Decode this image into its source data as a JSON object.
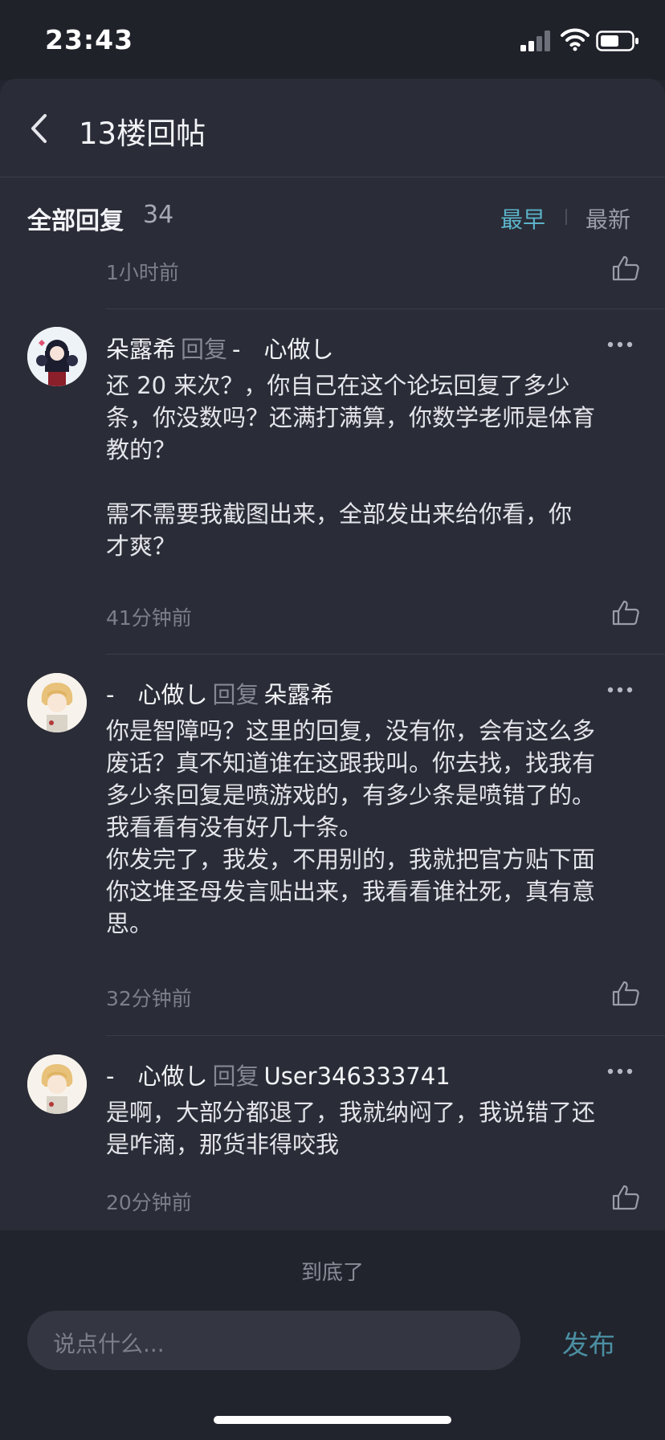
{
  "status": {
    "time": "23:43"
  },
  "nav": {
    "title": "13楼回帖"
  },
  "sort": {
    "all_replies": "全部回复",
    "count": "34",
    "earliest": "最早",
    "newest": "最新"
  },
  "top_item": {
    "time": "1小时前"
  },
  "comments": [
    {
      "user": "朵露希",
      "reply_word": "回复",
      "target": "-　心做し",
      "text": "还 20 来次？，你自己在这个论坛回复了多少\n条，你没数吗？还满打满算，你数学老师是体育\n教的？\n\n需不需要我截图出来，全部发出来给你看，你\n才爽？",
      "time": "41分钟前"
    },
    {
      "user": "-　心做し",
      "reply_word": "回复",
      "target": "朵露希",
      "text": "你是智障吗？这里的回复，没有你，会有这么多\n废话？真不知道谁在这跟我叫。你去找，找我有\n多少条回复是喷游戏的，有多少条是喷错了的。\n我看看有没有好几十条。\n你发完了，我发，不用别的，我就把官方贴下面\n你这堆圣母发言贴出来，我看看谁社死，真有意\n思。",
      "time": "32分钟前"
    },
    {
      "user": "-　心做し",
      "reply_word": "回复",
      "target": "User346333741",
      "text": "是啊，大部分都退了，我就纳闷了，我说错了还\n是咋滴，那货非得咬我",
      "time": "20分钟前"
    }
  ],
  "footer": {
    "end_text": "到底了",
    "placeholder": "说点什么...",
    "publish": "发布"
  },
  "colors": {
    "accent": "#5bb3c9",
    "background": "#2a2c37"
  },
  "icons": [
    "back-icon",
    "like-icon",
    "more-icon",
    "signal-icon",
    "wifi-icon",
    "battery-icon"
  ]
}
